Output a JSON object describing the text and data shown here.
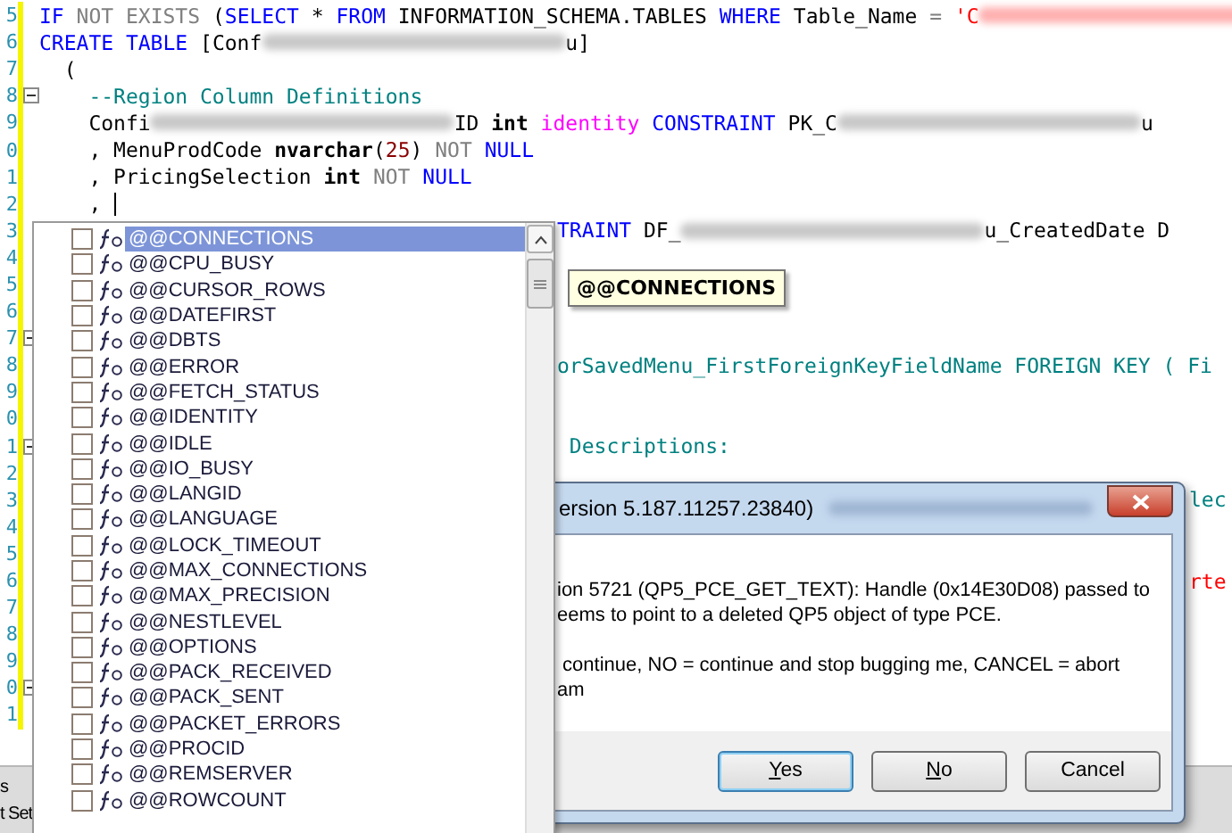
{
  "editor": {
    "lines": [
      {
        "number": "5",
        "kind": "full",
        "fold_marker": false,
        "segments": [
          {
            "kind": "kw",
            "text": "IF"
          },
          {
            "kind": "gray",
            "text": " NOT EXISTS"
          },
          {
            "kind": "plain",
            "text": " ("
          },
          {
            "kind": "kw",
            "text": "SELECT"
          },
          {
            "kind": "plain",
            "text": " * "
          },
          {
            "kind": "kw",
            "text": "FROM"
          },
          {
            "kind": "plain",
            "text": " INFORMATION_SCHEMA.TABLES "
          },
          {
            "kind": "kw",
            "text": "WHERE"
          },
          {
            "kind": "plain",
            "text": " Table_Name "
          },
          {
            "kind": "gray",
            "text": "="
          },
          {
            "kind": "str",
            "text": " 'C"
          },
          {
            "kind": "blur-str"
          }
        ]
      },
      {
        "number": "6",
        "kind": "full",
        "fold_marker": false,
        "segments": [
          {
            "kind": "kw",
            "text": "CREATE TABLE"
          },
          {
            "kind": "plain",
            "text": " [Conf"
          },
          {
            "kind": "blur"
          },
          {
            "kind": "plain",
            "text": "u]"
          }
        ]
      },
      {
        "number": "7",
        "kind": "full",
        "fold_marker": false,
        "segments": [
          {
            "kind": "plain",
            "text": "  ("
          }
        ]
      },
      {
        "number": "8",
        "kind": "full",
        "fold_marker": true,
        "segments": [
          {
            "kind": "comment",
            "text": "    --Region Column Definitions"
          }
        ]
      },
      {
        "number": "9",
        "kind": "full",
        "fold_marker": false,
        "segments": [
          {
            "kind": "plain",
            "text": "    Confi"
          },
          {
            "kind": "blur"
          },
          {
            "kind": "plain",
            "text": "ID "
          },
          {
            "kind": "type",
            "text": "int"
          },
          {
            "kind": "fn",
            "text": " identity"
          },
          {
            "kind": "kw",
            "text": " CONSTRAINT"
          },
          {
            "kind": "plain",
            "text": " PK_C"
          },
          {
            "kind": "blur"
          },
          {
            "kind": "plain",
            "text": "u"
          }
        ]
      },
      {
        "number": "0",
        "kind": "full",
        "fold_marker": false,
        "segments": [
          {
            "kind": "plain",
            "text": "    , MenuProdCode "
          },
          {
            "kind": "type",
            "text": "nvarchar"
          },
          {
            "kind": "plain",
            "text": "("
          },
          {
            "kind": "num",
            "text": "25"
          },
          {
            "kind": "plain",
            "text": ") "
          },
          {
            "kind": "gray",
            "text": "NOT"
          },
          {
            "kind": "kw",
            "text": " NULL"
          }
        ]
      },
      {
        "number": "1",
        "kind": "full",
        "fold_marker": false,
        "segments": [
          {
            "kind": "plain",
            "text": "    , PricingSelection "
          },
          {
            "kind": "type",
            "text": "int"
          },
          {
            "kind": "gray",
            "text": " NOT"
          },
          {
            "kind": "kw",
            "text": " NULL"
          }
        ]
      },
      {
        "number": "2",
        "kind": "full",
        "fold_marker": false,
        "segments": [
          {
            "kind": "plain",
            "text": "    , "
          },
          {
            "kind": "caret"
          }
        ]
      },
      {
        "number": "3",
        "kind": "tail",
        "fold_marker": false,
        "segments": [
          {
            "kind": "kw",
            "text": "TRAINT"
          },
          {
            "kind": "plain",
            "text": " DF_"
          },
          {
            "kind": "blur"
          },
          {
            "kind": "plain",
            "text": "u_CreatedDate D"
          }
        ]
      },
      {
        "number": "4",
        "kind": "tail",
        "fold_marker": false
      },
      {
        "number": "5",
        "kind": "tail",
        "fold_marker": false
      },
      {
        "number": "6",
        "kind": "tail",
        "fold_marker": false
      },
      {
        "number": "7",
        "kind": "tail",
        "fold_marker": true
      },
      {
        "number": "8",
        "kind": "tail",
        "fold_marker": false,
        "segments": [
          {
            "kind": "comment",
            "text": "orSavedMenu_FirstForeignKeyFieldName FOREIGN KEY ( Fi"
          }
        ]
      },
      {
        "number": "9",
        "kind": "tail",
        "fold_marker": false
      },
      {
        "number": "0",
        "kind": "tail",
        "fold_marker": false
      },
      {
        "number": "1",
        "kind": "tail",
        "fold_marker": true,
        "segments": [
          {
            "kind": "comment",
            "text": " Descriptions:"
          }
        ]
      },
      {
        "number": "2",
        "kind": "tail",
        "fold_marker": false
      },
      {
        "number": "3",
        "kind": "far",
        "fold_marker": false,
        "segments": [
          {
            "kind": "comment",
            "text": "lec"
          }
        ]
      },
      {
        "number": "4",
        "kind": "far",
        "fold_marker": false
      },
      {
        "number": "5",
        "kind": "far",
        "fold_marker": false
      },
      {
        "number": "6",
        "kind": "far",
        "fold_marker": false,
        "segments": [
          {
            "kind": "str",
            "text": "rte"
          }
        ]
      },
      {
        "number": "7",
        "kind": "far",
        "fold_marker": false
      },
      {
        "number": "8",
        "kind": "far",
        "fold_marker": false
      },
      {
        "number": "9",
        "kind": "far",
        "fold_marker": false
      },
      {
        "number": "0",
        "kind": "far",
        "fold_marker": true
      },
      {
        "number": "1",
        "kind": "far",
        "fold_marker": false
      }
    ]
  },
  "bottom_tabs": [
    {
      "label": "s"
    },
    {
      "label": "t Set"
    }
  ],
  "completion_list": {
    "items": [
      {
        "label": "@@CONNECTIONS",
        "checked": false,
        "selected": true
      },
      {
        "label": "@@CPU_BUSY",
        "checked": false,
        "selected": false
      },
      {
        "label": "@@CURSOR_ROWS",
        "checked": false,
        "selected": false
      },
      {
        "label": "@@DATEFIRST",
        "checked": false,
        "selected": false
      },
      {
        "label": "@@DBTS",
        "checked": false,
        "selected": false
      },
      {
        "label": "@@ERROR",
        "checked": false,
        "selected": false
      },
      {
        "label": "@@FETCH_STATUS",
        "checked": false,
        "selected": false
      },
      {
        "label": "@@IDENTITY",
        "checked": false,
        "selected": false
      },
      {
        "label": "@@IDLE",
        "checked": false,
        "selected": false
      },
      {
        "label": "@@IO_BUSY",
        "checked": false,
        "selected": false
      },
      {
        "label": "@@LANGID",
        "checked": false,
        "selected": false
      },
      {
        "label": "@@LANGUAGE",
        "checked": false,
        "selected": false
      },
      {
        "label": "@@LOCK_TIMEOUT",
        "checked": false,
        "selected": false
      },
      {
        "label": "@@MAX_CONNECTIONS",
        "checked": false,
        "selected": false
      },
      {
        "label": "@@MAX_PRECISION",
        "checked": false,
        "selected": false
      },
      {
        "label": "@@NESTLEVEL",
        "checked": false,
        "selected": false
      },
      {
        "label": "@@OPTIONS",
        "checked": false,
        "selected": false
      },
      {
        "label": "@@PACK_RECEIVED",
        "checked": false,
        "selected": false
      },
      {
        "label": "@@PACK_SENT",
        "checked": false,
        "selected": false
      },
      {
        "label": "@@PACKET_ERRORS",
        "checked": false,
        "selected": false
      },
      {
        "label": "@@PROCID",
        "checked": false,
        "selected": false
      },
      {
        "label": "@@REMSERVER",
        "checked": false,
        "selected": false
      },
      {
        "label": "@@ROWCOUNT",
        "checked": false,
        "selected": false
      }
    ]
  },
  "tooltip": {
    "text": "@@CONNECTIONS"
  },
  "dialog": {
    "title": "ersion 5.187.11257.23840)",
    "paragraphs": [
      {
        "lines": [
          "ion 5721 (QP5_PCE_GET_TEXT): Handle (0x14E30D08) passed to",
          "eems to point to a deleted QP5 object of type PCE."
        ]
      },
      {
        "lines": [
          " continue, NO = continue and stop bugging me, CANCEL = abort",
          "am"
        ]
      }
    ],
    "buttons": [
      {
        "label": "Yes",
        "focused": true,
        "mnemonic": true
      },
      {
        "label": "No",
        "focused": false,
        "mnemonic": true
      },
      {
        "label": "Cancel",
        "focused": false,
        "mnemonic": false
      }
    ]
  }
}
